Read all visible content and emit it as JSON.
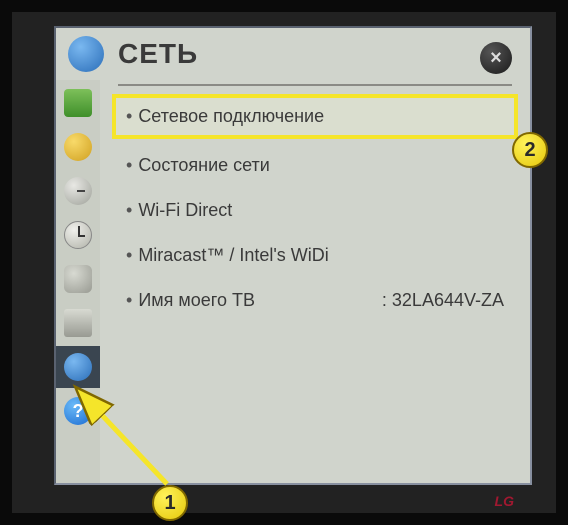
{
  "header": {
    "title": "СЕТЬ",
    "close_label": "×"
  },
  "sidebar": {
    "items": [
      {
        "name": "image-icon"
      },
      {
        "name": "audio-icon"
      },
      {
        "name": "channel-icon"
      },
      {
        "name": "time-icon"
      },
      {
        "name": "lock-icon"
      },
      {
        "name": "options-icon"
      },
      {
        "name": "network-icon"
      },
      {
        "name": "help-icon"
      }
    ]
  },
  "menu": {
    "items": [
      {
        "label": "Сетевое подключение"
      },
      {
        "label": "Состояние сети"
      },
      {
        "label": "Wi-Fi Direct"
      },
      {
        "label": "Miracast™ / Intel's WiDi"
      },
      {
        "label": "Имя моего ТВ",
        "value": ": 32LA644V-ZA"
      }
    ]
  },
  "callouts": {
    "one": "1",
    "two": "2"
  },
  "brand": "LG"
}
